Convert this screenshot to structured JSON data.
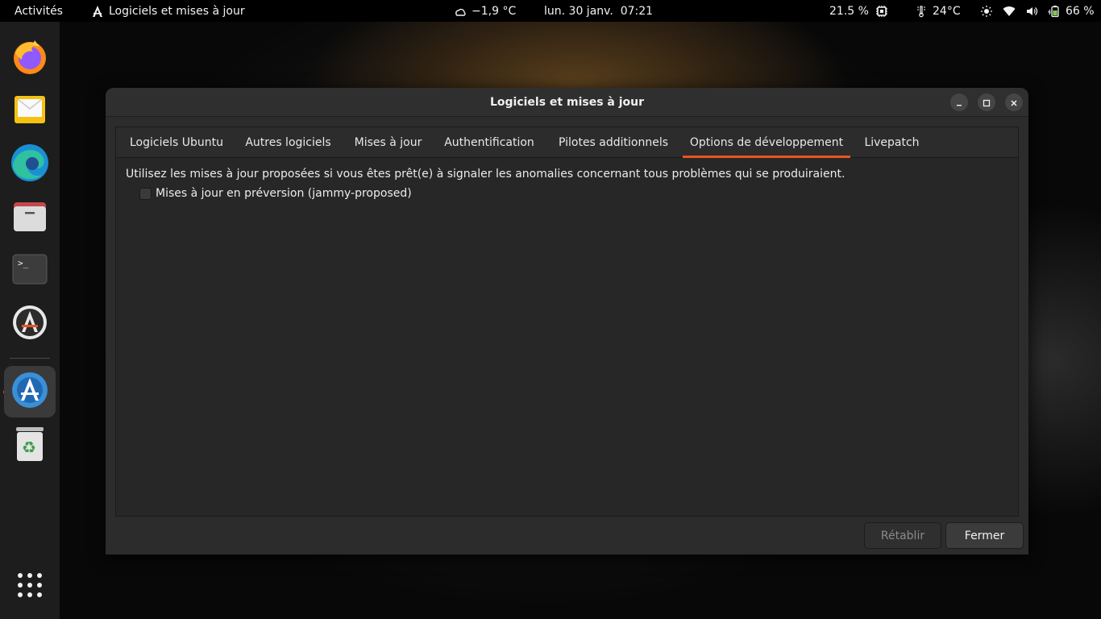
{
  "topbar": {
    "activities": "Activités",
    "app_name": "Logiciels et mises à jour",
    "weather": "−1,9 °C",
    "clock": "lun. 30 janv.  07:21",
    "cpu": "21.5 %",
    "temperature": "24°C",
    "battery": "66 %"
  },
  "dock": {
    "items": [
      {
        "name": "firefox-icon"
      },
      {
        "name": "mail-icon"
      },
      {
        "name": "edge-icon"
      },
      {
        "name": "files-icon"
      },
      {
        "name": "terminal-icon"
      },
      {
        "name": "software-updater-icon"
      },
      {
        "name": "software-properties-icon"
      },
      {
        "name": "trash-icon"
      },
      {
        "name": "app-grid-icon"
      }
    ]
  },
  "window": {
    "title": "Logiciels et mises à jour",
    "tabs": [
      {
        "label": "Logiciels Ubuntu"
      },
      {
        "label": "Autres logiciels"
      },
      {
        "label": "Mises à jour"
      },
      {
        "label": "Authentification"
      },
      {
        "label": "Pilotes additionnels"
      },
      {
        "label": "Options de développement",
        "selected": true
      },
      {
        "label": "Livepatch"
      }
    ],
    "description": "Utilisez les mises à jour proposées si vous êtes prêt(e) à signaler les anomalies concernant tous problèmes qui se produiraient.",
    "checkbox_label": "Mises à jour en préversion (jammy-proposed)",
    "checkbox_checked": false,
    "buttons": {
      "revert": "Rétablir",
      "close": "Fermer"
    }
  },
  "colors": {
    "accent": "#e95420"
  }
}
